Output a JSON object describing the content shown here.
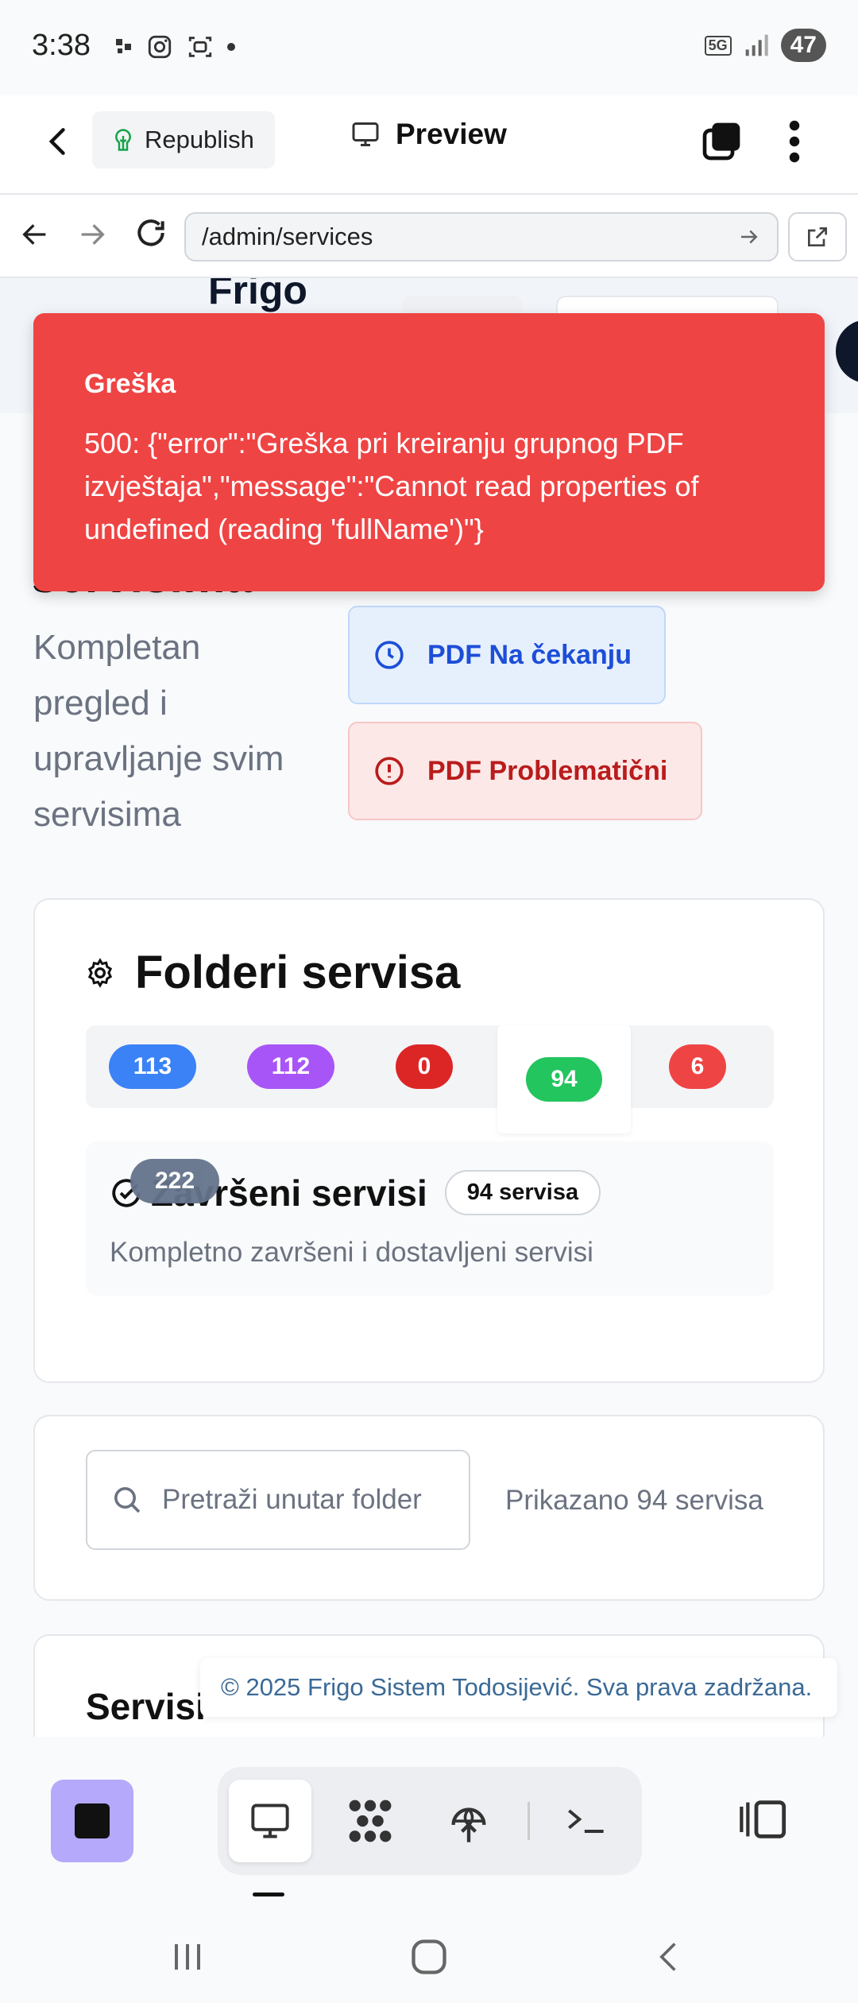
{
  "status_bar": {
    "time": "3:38",
    "battery": "47",
    "network": "5G"
  },
  "app_bar": {
    "republish_label": "Republish",
    "preview_label": "Preview"
  },
  "browser": {
    "url": "/admin/services"
  },
  "page": {
    "brand": "Frigo",
    "heading_fragment": "servisima",
    "subtitle": "Kompletan pregled i upravljanje svim servisima",
    "pdf_pending_label": "PDF Na čekanju",
    "pdf_problem_label": "PDF Problematični"
  },
  "toast": {
    "title": "Greška",
    "message": "500: {\"error\":\"Greška pri kreiranju grupnog PDF izvještaja\",\"message\":\"Cannot read properties of undefined (reading 'fullName')\"}"
  },
  "folders": {
    "title": "Folderi servisa",
    "tabs": [
      {
        "count": "113",
        "color": "#3b82f6"
      },
      {
        "count": "112",
        "color": "#a855f7"
      },
      {
        "count": "0",
        "color": "#dc2626"
      },
      {
        "count": "94",
        "color": "#22c55e"
      },
      {
        "count": "6",
        "color": "#ef4444"
      }
    ],
    "hidden_tab_count": "222",
    "selected": {
      "title": "Završeni servisi",
      "badge": "94 servisa",
      "description": "Kompletno završeni i dostavljeni servisi"
    }
  },
  "search": {
    "placeholder": "Pretraži unutar folder",
    "shown_count": "Prikazano 94 servisa"
  },
  "services": {
    "title": "Servisi"
  },
  "footer": {
    "text": "© 2025 Frigo Sistem Todosijević. Sva prava zadržana."
  }
}
